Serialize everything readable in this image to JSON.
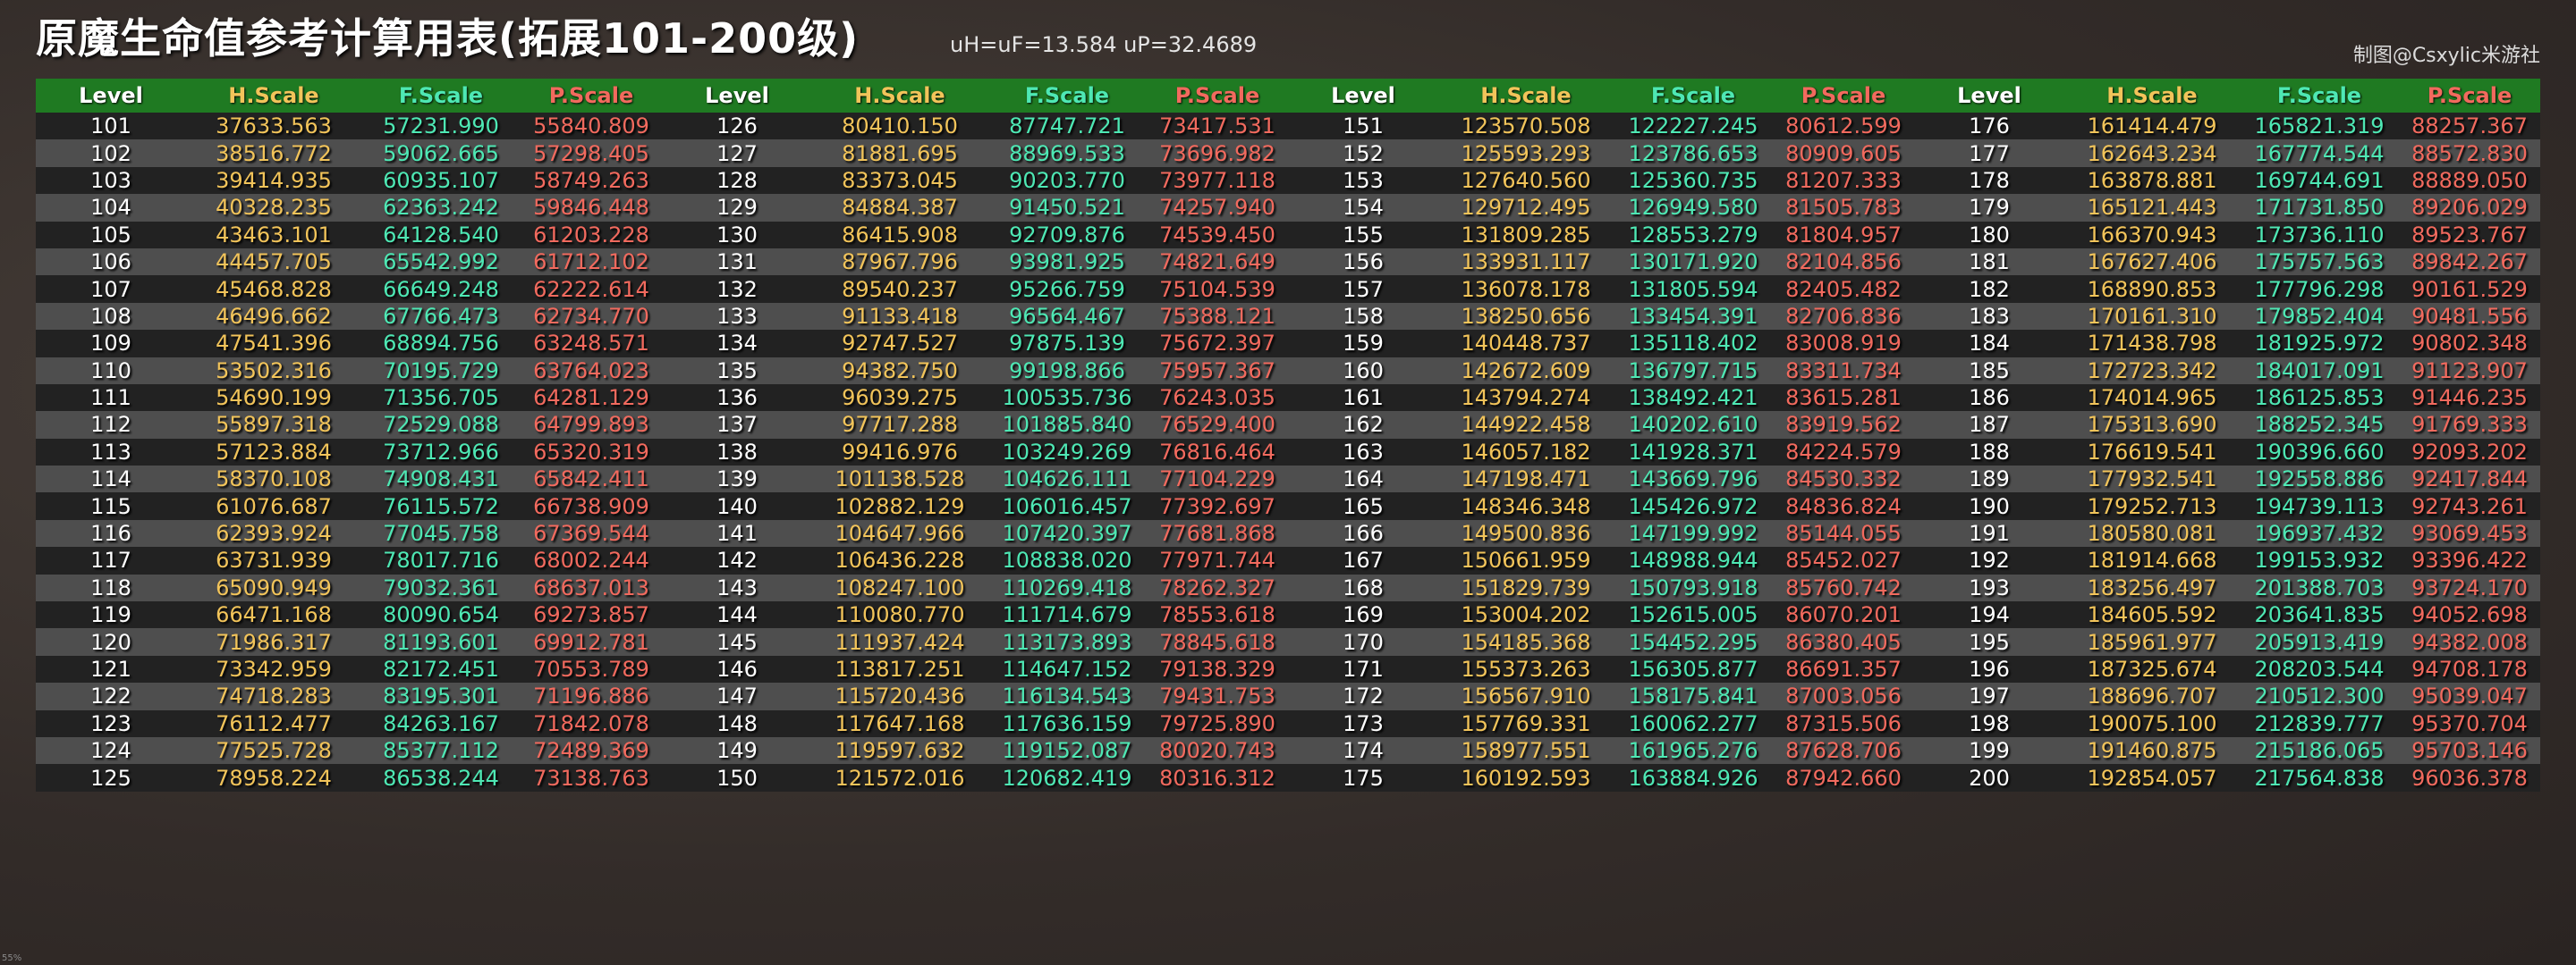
{
  "title": "原魔生命值参考计算用表(拓展101-200级)",
  "formula": "uH=uF=13.584 uP=32.4689",
  "credit": "制图@Csxylic米游社",
  "zoom_label": "55%",
  "colors": {
    "header_bg": "#1f7a22",
    "level": "#ffffff",
    "h_scale": "#f2c45a",
    "f_scale": "#4ee8b4",
    "p_scale": "#f26a5e"
  },
  "headers": [
    "Level",
    "H.Scale",
    "F.Scale",
    "P.Scale"
  ],
  "groups": [
    {
      "rows": [
        [
          "101",
          "37633.563",
          "57231.990",
          "55840.809"
        ],
        [
          "102",
          "38516.772",
          "59062.665",
          "57298.405"
        ],
        [
          "103",
          "39414.935",
          "60935.107",
          "58749.263"
        ],
        [
          "104",
          "40328.235",
          "62363.242",
          "59846.448"
        ],
        [
          "105",
          "43463.101",
          "64128.540",
          "61203.228"
        ],
        [
          "106",
          "44457.705",
          "65542.992",
          "61712.102"
        ],
        [
          "107",
          "45468.828",
          "66649.248",
          "62222.614"
        ],
        [
          "108",
          "46496.662",
          "67766.473",
          "62734.770"
        ],
        [
          "109",
          "47541.396",
          "68894.756",
          "63248.571"
        ],
        [
          "110",
          "53502.316",
          "70195.729",
          "63764.023"
        ],
        [
          "111",
          "54690.199",
          "71356.705",
          "64281.129"
        ],
        [
          "112",
          "55897.318",
          "72529.088",
          "64799.893"
        ],
        [
          "113",
          "57123.884",
          "73712.966",
          "65320.319"
        ],
        [
          "114",
          "58370.108",
          "74908.431",
          "65842.411"
        ],
        [
          "115",
          "61076.687",
          "76115.572",
          "66738.909"
        ],
        [
          "116",
          "62393.924",
          "77045.758",
          "67369.544"
        ],
        [
          "117",
          "63731.939",
          "78017.716",
          "68002.244"
        ],
        [
          "118",
          "65090.949",
          "79032.361",
          "68637.013"
        ],
        [
          "119",
          "66471.168",
          "80090.654",
          "69273.857"
        ],
        [
          "120",
          "71986.317",
          "81193.601",
          "69912.781"
        ],
        [
          "121",
          "73342.959",
          "82172.451",
          "70553.789"
        ],
        [
          "122",
          "74718.283",
          "83195.301",
          "71196.886"
        ],
        [
          "123",
          "76112.477",
          "84263.167",
          "71842.078"
        ],
        [
          "124",
          "77525.728",
          "85377.112",
          "72489.369"
        ],
        [
          "125",
          "78958.224",
          "86538.244",
          "73138.763"
        ]
      ]
    },
    {
      "rows": [
        [
          "126",
          "80410.150",
          "87747.721",
          "73417.531"
        ],
        [
          "127",
          "81881.695",
          "88969.533",
          "73696.982"
        ],
        [
          "128",
          "83373.045",
          "90203.770",
          "73977.118"
        ],
        [
          "129",
          "84884.387",
          "91450.521",
          "74257.940"
        ],
        [
          "130",
          "86415.908",
          "92709.876",
          "74539.450"
        ],
        [
          "131",
          "87967.796",
          "93981.925",
          "74821.649"
        ],
        [
          "132",
          "89540.237",
          "95266.759",
          "75104.539"
        ],
        [
          "133",
          "91133.418",
          "96564.467",
          "75388.121"
        ],
        [
          "134",
          "92747.527",
          "97875.139",
          "75672.397"
        ],
        [
          "135",
          "94382.750",
          "99198.866",
          "75957.367"
        ],
        [
          "136",
          "96039.275",
          "100535.736",
          "76243.035"
        ],
        [
          "137",
          "97717.288",
          "101885.840",
          "76529.400"
        ],
        [
          "138",
          "99416.976",
          "103249.269",
          "76816.464"
        ],
        [
          "139",
          "101138.528",
          "104626.111",
          "77104.229"
        ],
        [
          "140",
          "102882.129",
          "106016.457",
          "77392.697"
        ],
        [
          "141",
          "104647.966",
          "107420.397",
          "77681.868"
        ],
        [
          "142",
          "106436.228",
          "108838.020",
          "77971.744"
        ],
        [
          "143",
          "108247.100",
          "110269.418",
          "78262.327"
        ],
        [
          "144",
          "110080.770",
          "111714.679",
          "78553.618"
        ],
        [
          "145",
          "111937.424",
          "113173.893",
          "78845.618"
        ],
        [
          "146",
          "113817.251",
          "114647.152",
          "79138.329"
        ],
        [
          "147",
          "115720.436",
          "116134.543",
          "79431.753"
        ],
        [
          "148",
          "117647.168",
          "117636.159",
          "79725.890"
        ],
        [
          "149",
          "119597.632",
          "119152.087",
          "80020.743"
        ],
        [
          "150",
          "121572.016",
          "120682.419",
          "80316.312"
        ]
      ]
    },
    {
      "rows": [
        [
          "151",
          "123570.508",
          "122227.245",
          "80612.599"
        ],
        [
          "152",
          "125593.293",
          "123786.653",
          "80909.605"
        ],
        [
          "153",
          "127640.560",
          "125360.735",
          "81207.333"
        ],
        [
          "154",
          "129712.495",
          "126949.580",
          "81505.783"
        ],
        [
          "155",
          "131809.285",
          "128553.279",
          "81804.957"
        ],
        [
          "156",
          "133931.117",
          "130171.920",
          "82104.856"
        ],
        [
          "157",
          "136078.178",
          "131805.594",
          "82405.482"
        ],
        [
          "158",
          "138250.656",
          "133454.391",
          "82706.836"
        ],
        [
          "159",
          "140448.737",
          "135118.402",
          "83008.919"
        ],
        [
          "160",
          "142672.609",
          "136797.715",
          "83311.734"
        ],
        [
          "161",
          "143794.274",
          "138492.421",
          "83615.281"
        ],
        [
          "162",
          "144922.458",
          "140202.610",
          "83919.562"
        ],
        [
          "163",
          "146057.182",
          "141928.371",
          "84224.579"
        ],
        [
          "164",
          "147198.471",
          "143669.796",
          "84530.332"
        ],
        [
          "165",
          "148346.348",
          "145426.972",
          "84836.824"
        ],
        [
          "166",
          "149500.836",
          "147199.992",
          "85144.055"
        ],
        [
          "167",
          "150661.959",
          "148988.944",
          "85452.027"
        ],
        [
          "168",
          "151829.739",
          "150793.918",
          "85760.742"
        ],
        [
          "169",
          "153004.202",
          "152615.005",
          "86070.201"
        ],
        [
          "170",
          "154185.368",
          "154452.295",
          "86380.405"
        ],
        [
          "171",
          "155373.263",
          "156305.877",
          "86691.357"
        ],
        [
          "172",
          "156567.910",
          "158175.841",
          "87003.056"
        ],
        [
          "173",
          "157769.331",
          "160062.277",
          "87315.506"
        ],
        [
          "174",
          "158977.551",
          "161965.276",
          "87628.706"
        ],
        [
          "175",
          "160192.593",
          "163884.926",
          "87942.660"
        ]
      ]
    },
    {
      "rows": [
        [
          "176",
          "161414.479",
          "165821.319",
          "88257.367"
        ],
        [
          "177",
          "162643.234",
          "167774.544",
          "88572.830"
        ],
        [
          "178",
          "163878.881",
          "169744.691",
          "88889.050"
        ],
        [
          "179",
          "165121.443",
          "171731.850",
          "89206.029"
        ],
        [
          "180",
          "166370.943",
          "173736.110",
          "89523.767"
        ],
        [
          "181",
          "167627.406",
          "175757.563",
          "89842.267"
        ],
        [
          "182",
          "168890.853",
          "177796.298",
          "90161.529"
        ],
        [
          "183",
          "170161.310",
          "179852.404",
          "90481.556"
        ],
        [
          "184",
          "171438.798",
          "181925.972",
          "90802.348"
        ],
        [
          "185",
          "172723.342",
          "184017.091",
          "91123.907"
        ],
        [
          "186",
          "174014.965",
          "186125.853",
          "91446.235"
        ],
        [
          "187",
          "175313.690",
          "188252.345",
          "91769.333"
        ],
        [
          "188",
          "176619.541",
          "190396.660",
          "92093.202"
        ],
        [
          "189",
          "177932.541",
          "192558.886",
          "92417.844"
        ],
        [
          "190",
          "179252.713",
          "194739.113",
          "92743.261"
        ],
        [
          "191",
          "180580.081",
          "196937.432",
          "93069.453"
        ],
        [
          "192",
          "181914.668",
          "199153.932",
          "93396.422"
        ],
        [
          "193",
          "183256.497",
          "201388.703",
          "93724.170"
        ],
        [
          "194",
          "184605.592",
          "203641.835",
          "94052.698"
        ],
        [
          "195",
          "185961.977",
          "205913.419",
          "94382.008"
        ],
        [
          "196",
          "187325.674",
          "208203.544",
          "94708.178"
        ],
        [
          "197",
          "188696.707",
          "210512.300",
          "95039.047"
        ],
        [
          "198",
          "190075.100",
          "212839.777",
          "95370.704"
        ],
        [
          "199",
          "191460.875",
          "215186.065",
          "95703.146"
        ],
        [
          "200",
          "192854.057",
          "217564.838",
          "96036.378"
        ]
      ]
    }
  ]
}
